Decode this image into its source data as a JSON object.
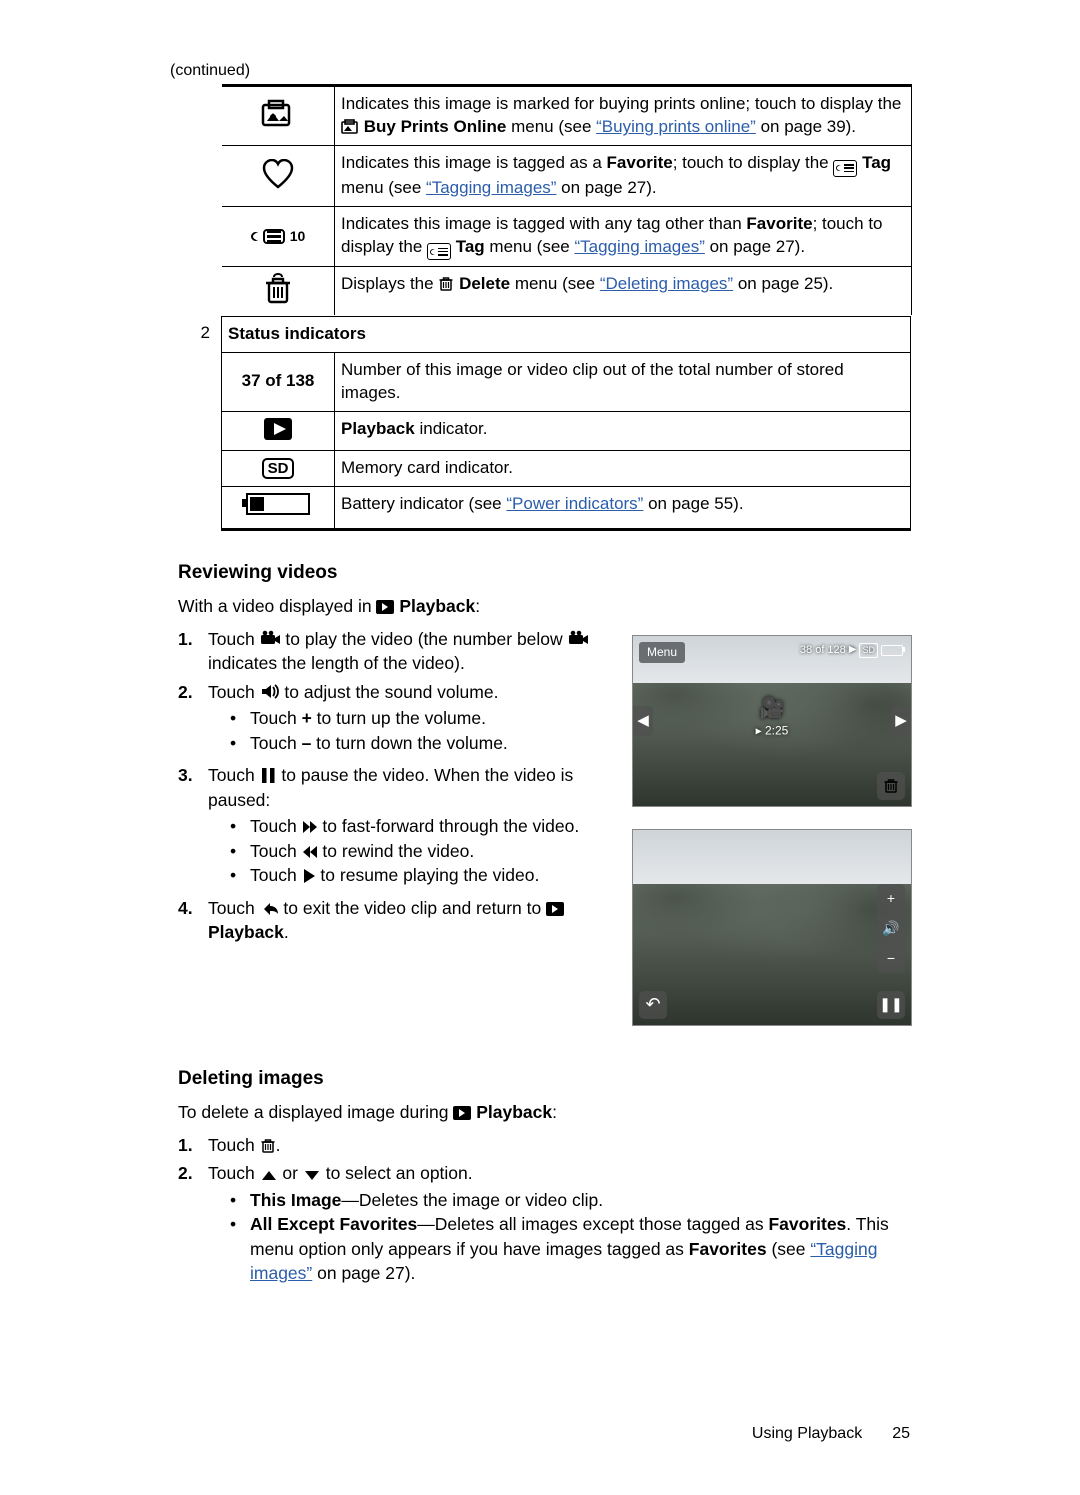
{
  "continued": "(continued)",
  "rows_top": [
    {
      "icon": "buy-prints-icon",
      "text_a": "Indicates this image is marked for buying prints online; touch to display the ",
      "icon_inline": "buy-prints-small-icon",
      "bold_a": "Buy Prints Online",
      "text_b": " menu (see ",
      "link": "“Buying prints online”",
      "text_c": " on page 39)."
    },
    {
      "icon": "heart-icon",
      "text_a": "Indicates this image is tagged as a ",
      "bold_a": "Favorite",
      "text_b": "; touch to display the ",
      "icon_inline": "tag-small-icon",
      "bold_b": " Tag",
      "text_c": " menu (see ",
      "link": "“Tagging images”",
      "text_d": " on page 27)."
    },
    {
      "icon": "tag-10-icon",
      "text_a": "Indicates this image is tagged with any tag other than ",
      "bold_a": "Favorite",
      "text_b": "; touch to display the ",
      "icon_inline": "tag-small-icon",
      "bold_b": " Tag",
      "text_c": " menu (see ",
      "link": "“Tagging images”",
      "text_d": " on page 27)."
    },
    {
      "icon": "trash-icon",
      "text_a": "Displays the ",
      "icon_inline": "trash-small-icon",
      "bold_a": "Delete",
      "text_b": " menu (see ",
      "link": "“Deleting images”",
      "text_c": " on page 25)."
    }
  ],
  "status_row_num": "2",
  "status_header": "Status indicators",
  "rows_status": [
    {
      "icon_text": "37 of 138",
      "desc": "Number of this image or video clip out of the total number of stored images."
    },
    {
      "icon": "playback-icon",
      "desc_bold": "Playback",
      "desc_rest": " indicator."
    },
    {
      "icon": "sd-icon",
      "desc": "Memory card indicator."
    },
    {
      "icon": "battery-icon",
      "desc_a": "Battery indicator (see ",
      "link": "“Power indicators”",
      "desc_b": " on page 55)."
    }
  ],
  "h_review": "Reviewing videos",
  "intro_review_a": "With a video displayed in ",
  "intro_review_b": "Playback",
  "steps_review": {
    "s1_a": "Touch ",
    "s1_b": " to play the video (the number below ",
    "s1_c": " indicates the length of the video).",
    "s2_a": "Touch ",
    "s2_b": " to adjust the sound volume.",
    "s2_bl1_a": "Touch ",
    "s2_bl1_bold": "+",
    "s2_bl1_b": " to turn up the volume.",
    "s2_bl2_a": "Touch ",
    "s2_bl2_bold": "–",
    "s2_bl2_b": " to turn down the volume.",
    "s3_a": "Touch ",
    "s3_b": " to pause the video. When the video is paused:",
    "s3_bl1_a": "Touch ",
    "s3_bl1_b": " to fast-forward through the video.",
    "s3_bl2_a": "Touch ",
    "s3_bl2_b": " to rewind the video.",
    "s3_bl3_a": "Touch ",
    "s3_bl3_b": " to resume playing the video.",
    "s4_a": "Touch ",
    "s4_b": " to exit the video clip and return to ",
    "s4_bold": "Playback",
    "s4_c": "."
  },
  "shot1": {
    "menu": "Menu",
    "count": "38 of 128",
    "sd": "SD",
    "time": "▸ 2:25"
  },
  "h_delete": "Deleting images",
  "intro_delete_a": "To delete a displayed image during ",
  "intro_delete_b": "Playback",
  "steps_delete": {
    "s1_a": "Touch ",
    "s2_a": "Touch ",
    "s2_b": " or ",
    "s2_c": " to select an option.",
    "bl1_bold": "This Image",
    "bl1_rest": "—Deletes the image or video clip.",
    "bl2_bold": "All Except Favorites",
    "bl2_a": "—Deletes all images except those tagged as ",
    "bl2_fav": "Favorites",
    "bl2_b": ". This menu option only appears if you have images tagged as ",
    "bl2_fav2": "Favorites",
    "bl2_c": " (see ",
    "bl2_link": "“Tagging images”",
    "bl2_d": " on page 27)."
  },
  "footer_text": "Using Playback",
  "footer_page": "25"
}
